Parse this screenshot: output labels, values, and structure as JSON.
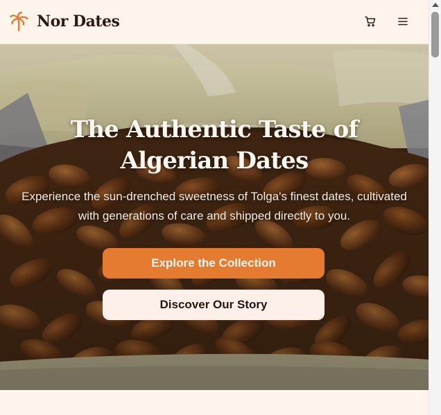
{
  "header": {
    "brand_name": "Nor Dates",
    "logo_icon": "palm-tree-icon",
    "cart_icon": "shopping-cart-icon",
    "menu_icon": "hamburger-menu-icon"
  },
  "hero": {
    "title": "The Authentic Taste of Algerian Dates",
    "subtitle": "Experience the sun-drenched sweetness of Tolga's finest dates, cultivated with generations of care and shipped directly to you.",
    "primary_button": "Explore the Collection",
    "secondary_button": "Discover Our Story"
  },
  "colors": {
    "accent": "#e57b31",
    "background": "#fdf4ec",
    "text_dark": "#2b1b12"
  }
}
